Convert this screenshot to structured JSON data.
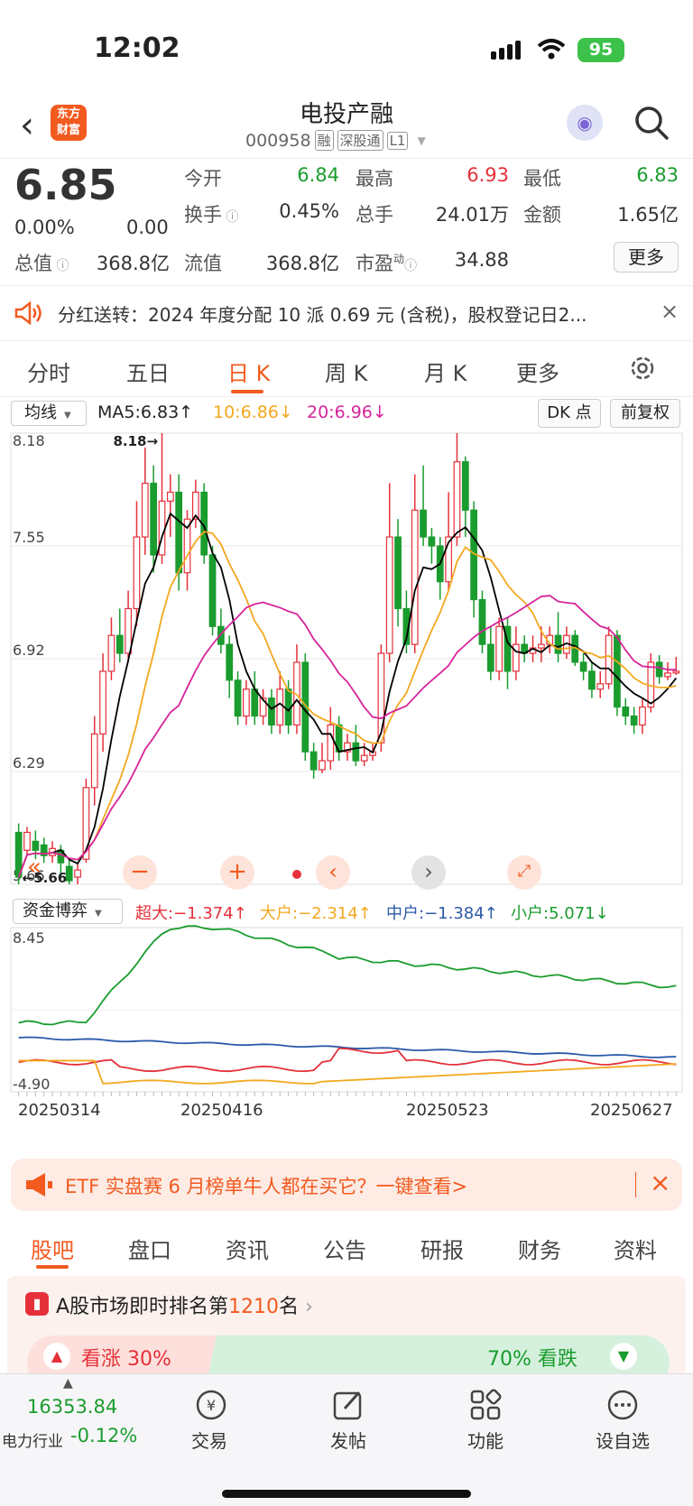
{
  "status": {
    "time": "12:02",
    "battery": "95"
  },
  "header": {
    "title": "电投产融",
    "code": "000958",
    "tags": [
      "融",
      "深股通",
      "L1"
    ],
    "logo_text": "东方\n财富"
  },
  "quote": {
    "price": "6.85",
    "change_pct": "0.00%",
    "change": "0.00",
    "open_label": "今开",
    "open": "6.84",
    "high_label": "最高",
    "high": "6.93",
    "low_label": "最低",
    "low": "6.83",
    "turnover_label": "换手",
    "turnover": "0.45%",
    "volume_label": "总手",
    "volume": "24.01万",
    "amount_label": "金额",
    "amount": "1.65亿",
    "mktcap_label": "总值",
    "mktcap": "368.8亿",
    "float_label": "流值",
    "float": "368.8亿",
    "pe_label": "市盈",
    "pe_sup": "动",
    "pe": "34.88",
    "more": "更多"
  },
  "dividend": {
    "icon": "speaker-icon",
    "text": "分红送转：2024 年度分配 10 派 0.69 元 (含税)，股权登记日2..."
  },
  "tabs": {
    "items": [
      "分时",
      "五日",
      "日 K",
      "周 K",
      "月 K",
      "更多"
    ],
    "active": 2
  },
  "chart": {
    "ma_select": "均线",
    "ma5": "MA5:6.83↑",
    "ma10": "10:6.86↓",
    "ma20": "20:6.96↓",
    "dk": "DK 点",
    "fq": "前复权",
    "y_labels": [
      "8.18",
      "7.55",
      "6.92",
      "6.29",
      "5.66"
    ],
    "max_label": "8.18→",
    "min_label": "←5.66",
    "ind_select": "资金博弈",
    "ind_super": "超大:−1.374↑",
    "ind_big": "大户:−2.314↑",
    "ind_mid": "中户:−1.384↑",
    "ind_small": "小户:5.071↓",
    "ind_y": [
      "8.45",
      "-4.90"
    ],
    "dates": [
      "20250314",
      "20250416",
      "20250523",
      "20250627"
    ],
    "colors": {
      "up": "#e5303a",
      "down": "#1a9c2e",
      "ma5": "#000000",
      "ma10": "#f3a81f",
      "ma20": "#d6249b"
    }
  },
  "ad": {
    "text": "ETF 实盘赛 6 月榜单牛人都在买它？一键查看>"
  },
  "subtabs": [
    "股吧",
    "盘口",
    "资讯",
    "公告",
    "研报",
    "财务",
    "资料"
  ],
  "rank": {
    "prefix": "A股市场即时排名第",
    "num": "1210",
    "suffix": "名",
    "up": "看涨 30%",
    "down": "70% 看跌"
  },
  "bottom": {
    "index": "16353.84",
    "sector": "电力行业",
    "sector_chg": "-0.12%",
    "nav": [
      "交易",
      "发帖",
      "功能",
      "设自选"
    ]
  },
  "chart_data": {
    "type": "candlestick",
    "ylim": [
      5.66,
      8.18
    ],
    "x_labels": [
      "20250314",
      "20250416",
      "20250523",
      "20250627"
    ],
    "series": [
      {
        "name": "MA5",
        "last": 6.83
      },
      {
        "name": "10",
        "last": 6.86
      },
      {
        "name": "20",
        "last": 6.96
      }
    ],
    "candles": [
      [
        5.95,
        5.7,
        6.0,
        5.66
      ],
      [
        5.85,
        5.95,
        5.98,
        5.82
      ],
      [
        5.9,
        5.85,
        5.96,
        5.8
      ],
      [
        5.88,
        5.82,
        5.92,
        5.78
      ],
      [
        5.82,
        5.86,
        5.9,
        5.78
      ],
      [
        5.85,
        5.78,
        5.88,
        5.7
      ],
      [
        5.76,
        5.68,
        5.8,
        5.66
      ],
      [
        5.7,
        5.74,
        5.78,
        5.66
      ],
      [
        5.8,
        6.2,
        6.25,
        5.78
      ],
      [
        6.2,
        6.5,
        6.6,
        6.1
      ],
      [
        6.5,
        6.85,
        6.95,
        6.4
      ],
      [
        6.85,
        7.05,
        7.15,
        6.8
      ],
      [
        7.05,
        6.95,
        7.2,
        6.9
      ],
      [
        6.95,
        7.2,
        7.3,
        6.9
      ],
      [
        7.2,
        7.6,
        7.8,
        7.1
      ],
      [
        7.6,
        7.9,
        8.1,
        7.5
      ],
      [
        7.9,
        7.5,
        8.0,
        7.4
      ],
      [
        7.5,
        7.8,
        8.18,
        7.45
      ],
      [
        7.8,
        7.85,
        7.95,
        7.6
      ],
      [
        7.85,
        7.4,
        7.95,
        7.3
      ],
      [
        7.4,
        7.7,
        7.75,
        7.3
      ],
      [
        7.7,
        7.85,
        7.92,
        7.65
      ],
      [
        7.85,
        7.5,
        7.9,
        7.45
      ],
      [
        7.5,
        7.1,
        7.55,
        7.05
      ],
      [
        7.1,
        7.0,
        7.2,
        6.95
      ],
      [
        7.0,
        6.8,
        7.05,
        6.7
      ],
      [
        6.8,
        6.6,
        6.85,
        6.55
      ],
      [
        6.6,
        6.75,
        6.8,
        6.55
      ],
      [
        6.75,
        6.6,
        6.85,
        6.55
      ],
      [
        6.6,
        6.7,
        6.75,
        6.55
      ],
      [
        6.7,
        6.55,
        6.75,
        6.5
      ],
      [
        6.55,
        6.75,
        6.85,
        6.5
      ],
      [
        6.75,
        6.55,
        6.8,
        6.5
      ],
      [
        6.55,
        6.9,
        7.0,
        6.5
      ],
      [
        6.9,
        6.4,
        6.95,
        6.35
      ],
      [
        6.4,
        6.3,
        6.45,
        6.25
      ],
      [
        6.3,
        6.35,
        6.45,
        6.28
      ],
      [
        6.35,
        6.55,
        6.65,
        6.3
      ],
      [
        6.55,
        6.4,
        6.6,
        6.35
      ],
      [
        6.4,
        6.45,
        6.5,
        6.35
      ],
      [
        6.45,
        6.35,
        6.55,
        6.32
      ],
      [
        6.35,
        6.38,
        6.45,
        6.32
      ],
      [
        6.38,
        6.4,
        6.45,
        6.35
      ],
      [
        6.45,
        6.95,
        7.0,
        6.4
      ],
      [
        6.95,
        7.6,
        7.9,
        6.9
      ],
      [
        7.6,
        7.2,
        7.7,
        7.1
      ],
      [
        7.2,
        7.0,
        7.3,
        6.95
      ],
      [
        7.0,
        7.75,
        7.95,
        6.95
      ],
      [
        7.75,
        7.6,
        8.0,
        7.55
      ],
      [
        7.6,
        7.55,
        7.65,
        7.45
      ],
      [
        7.55,
        7.35,
        7.6,
        7.25
      ],
      [
        7.35,
        7.6,
        7.85,
        7.3
      ],
      [
        7.6,
        8.02,
        8.18,
        7.55
      ],
      [
        8.02,
        7.75,
        8.05,
        7.6
      ],
      [
        7.75,
        7.25,
        7.8,
        7.15
      ],
      [
        7.25,
        7.0,
        7.3,
        6.95
      ],
      [
        7.0,
        6.85,
        7.1,
        6.8
      ],
      [
        6.85,
        7.1,
        7.15,
        6.8
      ],
      [
        7.1,
        6.85,
        7.15,
        6.75
      ],
      [
        6.85,
        7.0,
        7.1,
        6.8
      ],
      [
        7.0,
        6.95,
        7.05,
        6.9
      ],
      [
        6.95,
        6.98,
        7.05,
        6.9
      ],
      [
        6.98,
        7.0,
        7.1,
        6.9
      ],
      [
        7.0,
        7.05,
        7.1,
        6.95
      ],
      [
        7.05,
        6.95,
        7.18,
        6.9
      ],
      [
        6.95,
        7.05,
        7.1,
        6.92
      ],
      [
        7.05,
        6.9,
        7.08,
        6.88
      ],
      [
        6.9,
        6.85,
        6.95,
        6.8
      ],
      [
        6.85,
        6.75,
        6.9,
        6.7
      ],
      [
        6.75,
        6.78,
        6.85,
        6.7
      ],
      [
        6.78,
        7.05,
        7.1,
        6.75
      ],
      [
        7.05,
        6.65,
        7.08,
        6.6
      ],
      [
        6.65,
        6.6,
        6.7,
        6.55
      ],
      [
        6.6,
        6.55,
        6.65,
        6.5
      ],
      [
        6.55,
        6.65,
        6.7,
        6.5
      ],
      [
        6.65,
        6.9,
        6.95,
        6.62
      ],
      [
        6.9,
        6.82,
        6.94,
        6.78
      ],
      [
        6.82,
        6.84,
        6.9,
        6.8
      ],
      [
        6.84,
        6.85,
        6.93,
        6.83
      ]
    ]
  }
}
